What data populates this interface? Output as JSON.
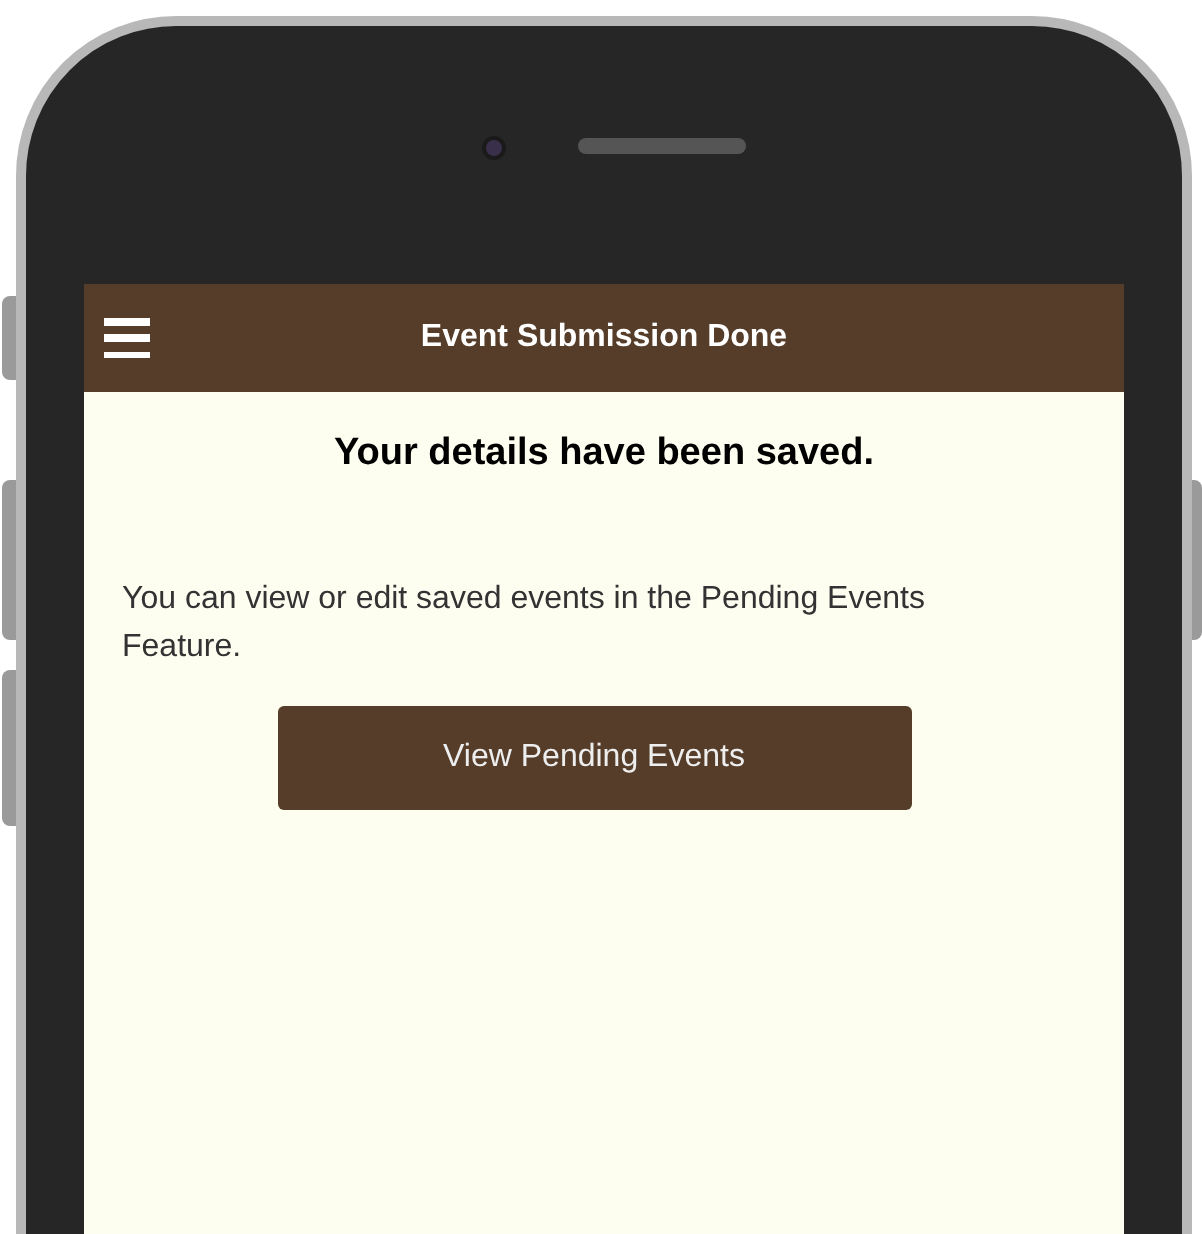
{
  "header": {
    "title": "Event Submission Done"
  },
  "content": {
    "heading": "Your details have been saved.",
    "message": "You can view or edit saved events in the Pending Events Feature.",
    "button": "View Pending Events"
  }
}
